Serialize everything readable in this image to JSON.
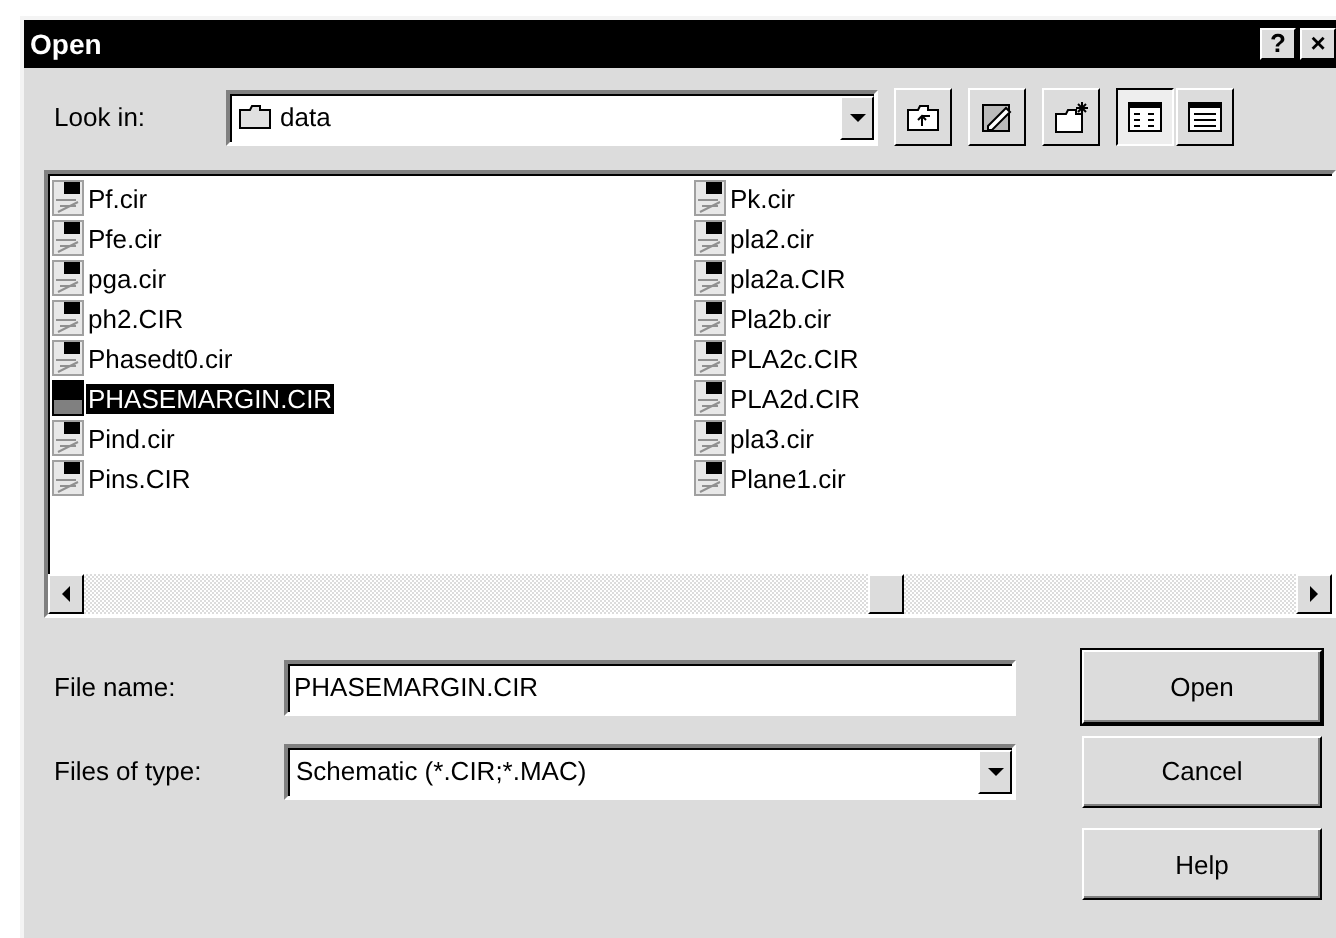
{
  "window": {
    "title": "Open",
    "help_button": "?",
    "close_button": "×"
  },
  "look_in": {
    "label": "Look in:",
    "value": "data"
  },
  "view_buttons": [
    {
      "kind": "list",
      "selected": true
    },
    {
      "kind": "details",
      "selected": false
    }
  ],
  "files": [
    {
      "name": "Pf.cir",
      "selected": false
    },
    {
      "name": "Pfe.cir",
      "selected": false
    },
    {
      "name": "pga.cir",
      "selected": false
    },
    {
      "name": "ph2.CIR",
      "selected": false
    },
    {
      "name": "Phasedt0.cir",
      "selected": false
    },
    {
      "name": "PHASEMARGIN.CIR",
      "selected": true
    },
    {
      "name": "Pind.cir",
      "selected": false
    },
    {
      "name": "Pins.CIR",
      "selected": false
    },
    {
      "name": "Pk.cir",
      "selected": false
    },
    {
      "name": "pla2.cir",
      "selected": false
    },
    {
      "name": "pla2a.CIR",
      "selected": false
    },
    {
      "name": "Pla2b.cir",
      "selected": false
    },
    {
      "name": "PLA2c.CIR",
      "selected": false
    },
    {
      "name": "PLA2d.CIR",
      "selected": false
    },
    {
      "name": "pla3.cir",
      "selected": false
    },
    {
      "name": "Plane1.cir",
      "selected": false
    }
  ],
  "file_name": {
    "label": "File name:",
    "value": "PHASEMARGIN.CIR"
  },
  "file_type": {
    "label": "Files of type:",
    "value": "Schematic (*.CIR;*.MAC)"
  },
  "buttons": [
    {
      "label": "Open",
      "default": true
    },
    {
      "label": "Cancel",
      "default": false
    },
    {
      "label": "Help",
      "default": false
    }
  ]
}
